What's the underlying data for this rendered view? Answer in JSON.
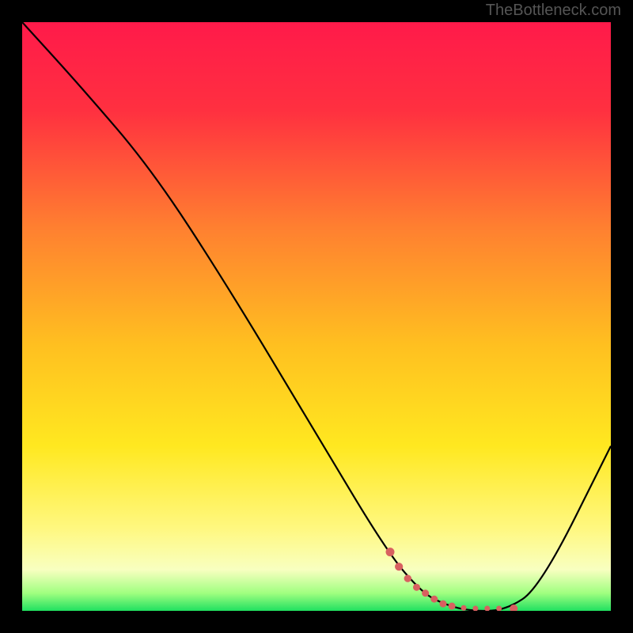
{
  "watermark": "TheBottleneck.com",
  "chart_data": {
    "type": "line",
    "title": "",
    "xlabel": "",
    "ylabel": "",
    "xlim": [
      0,
      100
    ],
    "ylim": [
      0,
      100
    ],
    "gradient_stops": [
      {
        "offset": 0,
        "color": "#ff1a4a"
      },
      {
        "offset": 15,
        "color": "#ff3040"
      },
      {
        "offset": 35,
        "color": "#ff8030"
      },
      {
        "offset": 55,
        "color": "#ffc020"
      },
      {
        "offset": 72,
        "color": "#ffe820"
      },
      {
        "offset": 86,
        "color": "#fff880"
      },
      {
        "offset": 93,
        "color": "#f8ffc0"
      },
      {
        "offset": 97,
        "color": "#a0ff80"
      },
      {
        "offset": 100,
        "color": "#20e060"
      }
    ],
    "series": [
      {
        "name": "bottleneck-curve",
        "color": "#000000",
        "x": [
          0,
          10,
          22,
          35,
          50,
          62,
          68,
          72,
          76,
          82,
          88,
          100
        ],
        "values": [
          100,
          89,
          75,
          55,
          30,
          10,
          3,
          1,
          0,
          0,
          4,
          28
        ]
      }
    ],
    "dotted_segment": {
      "color": "#d86060",
      "points": [
        {
          "x": 62.5,
          "y": 10
        },
        {
          "x": 64,
          "y": 7.5
        },
        {
          "x": 65.5,
          "y": 5.5
        },
        {
          "x": 67,
          "y": 4
        },
        {
          "x": 68.5,
          "y": 3
        },
        {
          "x": 70,
          "y": 2
        },
        {
          "x": 71.5,
          "y": 1.2
        },
        {
          "x": 73,
          "y": 0.8
        },
        {
          "x": 75,
          "y": 0.5
        },
        {
          "x": 77,
          "y": 0.4
        },
        {
          "x": 79,
          "y": 0.4
        },
        {
          "x": 81,
          "y": 0.4
        },
        {
          "x": 83.5,
          "y": 0.4
        }
      ]
    }
  }
}
